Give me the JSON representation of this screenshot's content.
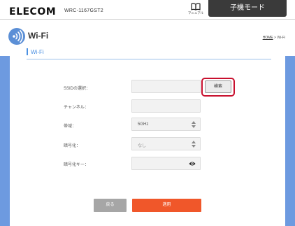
{
  "header": {
    "brand": "ELECOM",
    "model": "WRC-1167GST2",
    "manual_label": "マニュアル",
    "mode_tab": "子機モード"
  },
  "page": {
    "title": "Wi-Fi",
    "breadcrumb_home": "HOME",
    "breadcrumb_sep": " > ",
    "breadcrumb_current": "Wi-Fi"
  },
  "section": {
    "title": "Wi-Fi"
  },
  "form": {
    "ssid_label": "SSIDの選択：",
    "ssid_value": "",
    "search_button": "検索",
    "channel_label": "チャンネル：",
    "channel_value": "",
    "band_label": "帯域：",
    "band_value": "5GHz",
    "encryption_label": "暗号化：",
    "encryption_value": "なし",
    "key_label": "暗号化キー：",
    "key_value": ""
  },
  "buttons": {
    "back": "戻る",
    "apply": "適用"
  },
  "colors": {
    "accent_blue": "#4a90e2",
    "side_blue": "#6d9ae0",
    "apply_orange": "#f0572a",
    "highlight_red": "#c8102e"
  },
  "icons": [
    "manual-book-icon",
    "wifi-icon",
    "chevron-updown-icon",
    "eye-icon"
  ]
}
